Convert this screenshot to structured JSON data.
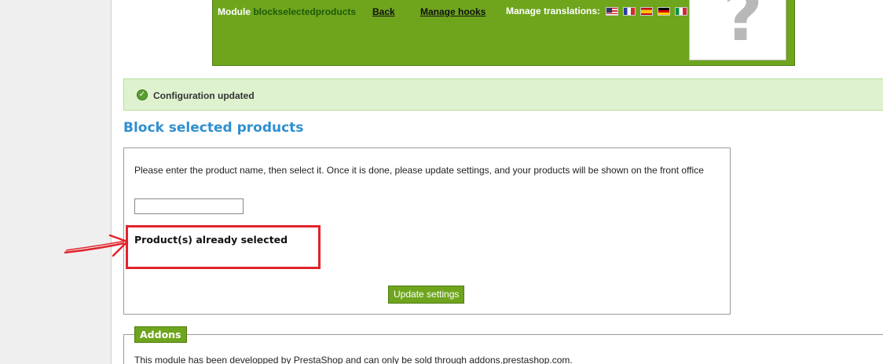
{
  "module_header": {
    "module_prefix": "Module",
    "module_name": "blockselectedproducts",
    "back_label": "Back",
    "manage_hooks_label": "Manage hooks",
    "manage_translations_label": "Manage translations:",
    "flags": [
      "us-flag-icon",
      "fr-flag-icon",
      "es-flag-icon",
      "de-flag-icon",
      "it-flag-icon"
    ],
    "logo_glyph": "?"
  },
  "confirmation": {
    "icon": "check-circle-icon",
    "text": "Configuration updated"
  },
  "page_title": "Block selected products",
  "settings": {
    "instructions": "Please enter the product name, then select it. Once it is done, please update settings, and your products will be shown on the front office",
    "product_input_value": "",
    "already_selected_label": "Product(s) already selected",
    "update_button_label": "Update settings"
  },
  "addons": {
    "legend": "Addons",
    "text": "This module has been developped by PrestaShop and can only be sold through addons.prestashop.com."
  },
  "colors": {
    "brand_green": "#6ea51d",
    "success_bg": "#dff2cf",
    "title_blue": "#2f8fcf",
    "annotation_red": "#e2232b"
  }
}
